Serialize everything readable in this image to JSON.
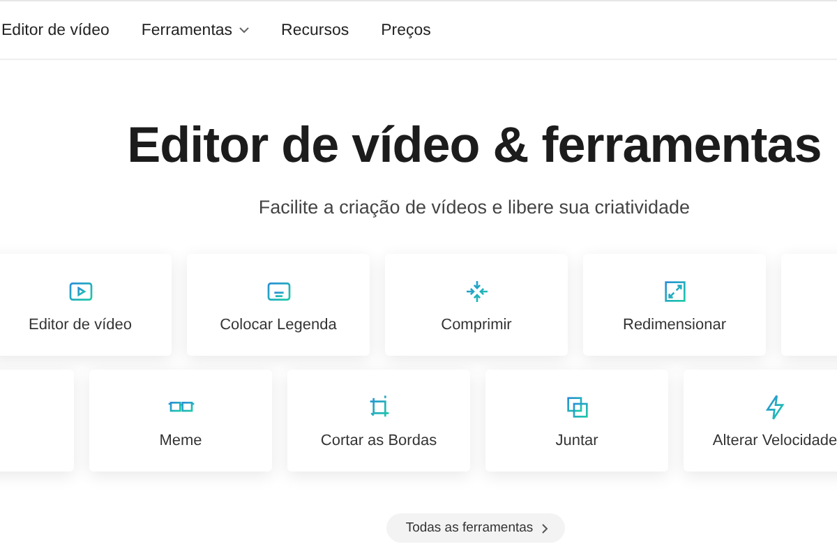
{
  "nav": {
    "items": [
      {
        "label": "Editor de vídeo",
        "kind": "link"
      },
      {
        "label": "Ferramentas",
        "kind": "dropdown"
      },
      {
        "label": "Recursos",
        "kind": "link"
      },
      {
        "label": "Preços",
        "kind": "link"
      }
    ]
  },
  "hero": {
    "title": "Editor de vídeo & ferramentas",
    "subtitle": "Facilite a criação de vídeos e libere sua criatividade"
  },
  "tool_rows": [
    [
      {
        "label": "Editor de vídeo"
      },
      {
        "label": "Colocar Legenda"
      },
      {
        "label": "Comprimir"
      },
      {
        "label": "Redimensionar"
      }
    ],
    [
      {
        "label": "Meme"
      },
      {
        "label": "Cortar as Bordas"
      },
      {
        "label": "Juntar"
      },
      {
        "label": "Alterar Velocidade"
      }
    ]
  ],
  "all_tools_button": {
    "label": "Todas as ferramentas"
  }
}
